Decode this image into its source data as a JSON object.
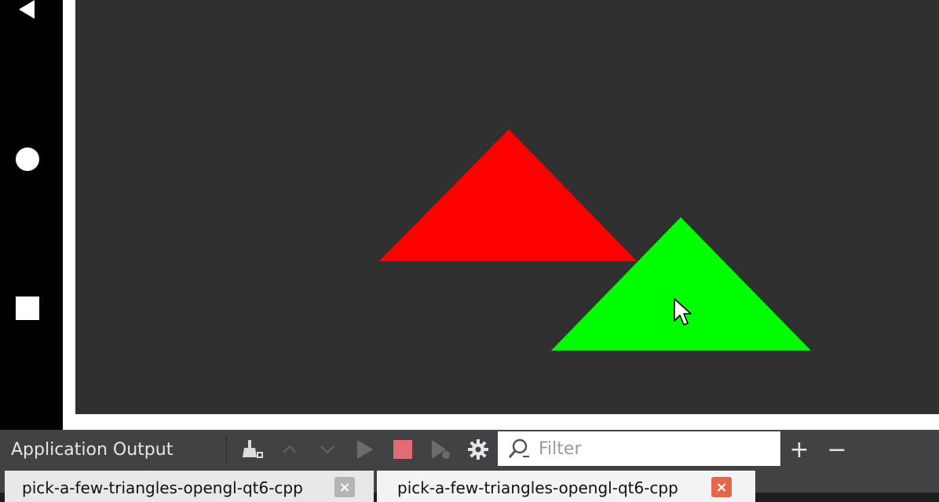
{
  "colors": {
    "canvas_bg": "#303030",
    "triangle_red": "#ff0000",
    "triangle_green": "#00ff00",
    "nav_bg": "#000000",
    "toolbar_bg": "#404244",
    "stop_red": "#e06c75",
    "tab_close_active": "#e5664a"
  },
  "nav": {
    "back_icon": "triangle-back-icon",
    "home_icon": "circle-home-icon",
    "recent_icon": "square-recent-icon"
  },
  "scene": {
    "triangles": [
      {
        "name": "red-triangle",
        "color": "#ff0000"
      },
      {
        "name": "green-triangle",
        "color": "#00ff00"
      }
    ]
  },
  "output_pane": {
    "title": "Application Output",
    "filter_placeholder": "Filter",
    "plus_label": "+",
    "minus_label": "−"
  },
  "tabs": [
    {
      "label": "pick-a-few-triangles-opengl-qt6-cpp",
      "close": "×",
      "active": false
    },
    {
      "label": "pick-a-few-triangles-opengl-qt6-cpp",
      "close": "×",
      "active": true
    }
  ]
}
